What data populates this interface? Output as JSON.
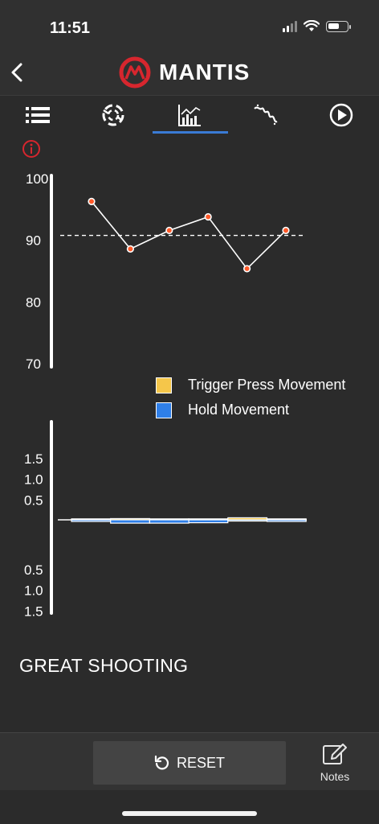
{
  "status": {
    "time": "11:51"
  },
  "header": {
    "brand": "MANTIS"
  },
  "tabs": [
    {
      "name": "list",
      "icon": "list-icon"
    },
    {
      "name": "target",
      "icon": "target-icon"
    },
    {
      "name": "chart",
      "icon": "chart-icon",
      "active": true
    },
    {
      "name": "trace",
      "icon": "trace-icon"
    },
    {
      "name": "play",
      "icon": "play-icon"
    }
  ],
  "colors": {
    "accent": "#3a7bd5",
    "brand_red": "#d7262e",
    "trigger": "#f5c64a",
    "hold": "#2f7fe8"
  },
  "chart_data": [
    {
      "type": "line",
      "x": [
        1,
        2,
        3,
        4,
        5,
        6
      ],
      "values": [
        96.3,
        88.6,
        91.6,
        93.8,
        85.4,
        91.6
      ],
      "reference_line": 90.8,
      "ylim": [
        70,
        100
      ],
      "yticks": [
        "100",
        "90",
        "80",
        "70"
      ],
      "title": "",
      "xlabel": "",
      "ylabel": ""
    },
    {
      "type": "bar",
      "categories": [
        "1",
        "2",
        "3",
        "4",
        "5",
        "6"
      ],
      "yticks_up": [
        "1.5",
        "1.0",
        "0.5"
      ],
      "yticks_down": [
        "0.5",
        "1.0",
        "1.5"
      ],
      "ylim": [
        -1.5,
        1.5
      ],
      "series": [
        {
          "name": "Trigger Press Movement",
          "values": [
            0.02,
            0.03,
            0.02,
            0.01,
            0.05,
            0.02
          ]
        },
        {
          "name": "Hold Movement",
          "values": [
            -0.04,
            -0.08,
            -0.08,
            -0.07,
            -0.03,
            -0.04
          ]
        }
      ]
    }
  ],
  "message": "GREAT SHOOTING",
  "footer": {
    "reset_label": "RESET",
    "notes_label": "Notes"
  }
}
